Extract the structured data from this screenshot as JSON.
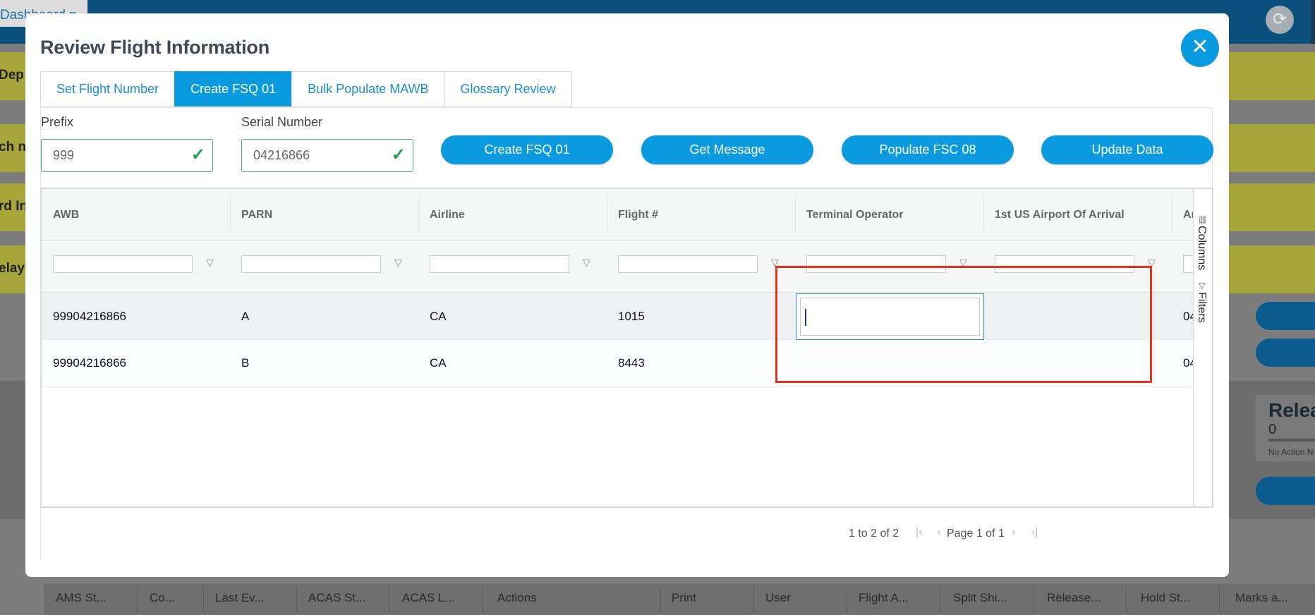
{
  "background": {
    "dashboard_label": "Dashboard ▾",
    "refresh_icon": "refresh-icon",
    "yellow_bars": [
      "Dep",
      "ch no",
      "rd In",
      "elaye"
    ],
    "release_card": {
      "title": "Relea",
      "count": "0",
      "subtitle": "No Action N"
    },
    "footer_columns": [
      "AMS St...",
      "Co...",
      "Last Ev...",
      "ACAS St...",
      "ACAS L...",
      "Actions",
      "Print",
      "User",
      "Flight A...",
      "Split Shi...",
      "Release...",
      "Hold St...",
      "Marks a..."
    ]
  },
  "modal": {
    "title": "Review Flight Information",
    "close_icon": "close-icon",
    "tabs": [
      {
        "label": "Set Flight Number",
        "active": false
      },
      {
        "label": "Create FSQ 01",
        "active": true
      },
      {
        "label": "Bulk Populate MAWB",
        "active": false
      },
      {
        "label": "Glossary Review",
        "active": false
      }
    ],
    "form": {
      "prefix": {
        "label": "Prefix",
        "value": "999"
      },
      "serial": {
        "label": "Serial Number",
        "value": "04216866"
      }
    },
    "actions": [
      "Create FSQ 01",
      "Get Message",
      "Populate FSC 08",
      "Update Data"
    ],
    "grid": {
      "columns": [
        "AWB",
        "PARN",
        "Airline",
        "Flight #",
        "Terminal Operator",
        "1st US Airport Of Arrival",
        "Ar"
      ],
      "rows": [
        {
          "awb": "99904216866",
          "parn": "A",
          "airline": "CA",
          "flight": "1015",
          "terminal": "",
          "airport": "",
          "extra": "04"
        },
        {
          "awb": "99904216866",
          "parn": "B",
          "airline": "CA",
          "flight": "8443",
          "terminal": "",
          "airport": "",
          "extra": "04"
        }
      ],
      "side_panel": {
        "columns": "Columns",
        "filters": "Filters"
      },
      "pagination": {
        "summary": "1 to 2 of 2",
        "page": "Page 1 of 1"
      }
    },
    "accent_color": "#0a9ae0",
    "highlight_color": "#e8321e"
  }
}
